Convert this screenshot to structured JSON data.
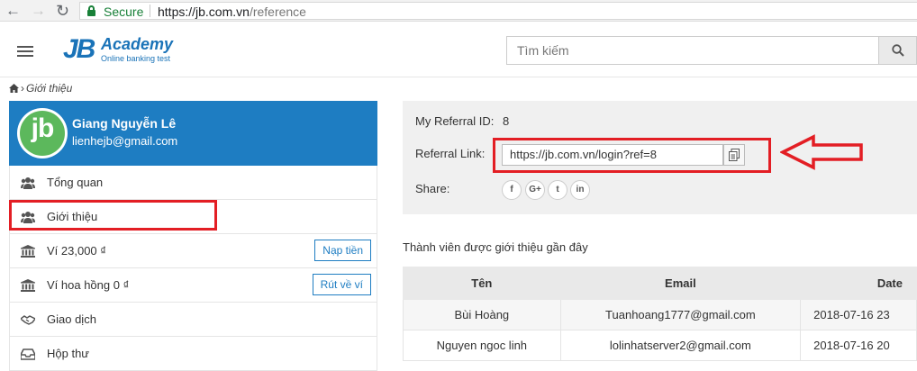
{
  "browser": {
    "secure_label": "Secure",
    "url_host": "https://jb.com.vn",
    "url_path": "/reference"
  },
  "header": {
    "logo_jb": "JB",
    "logo_academy": "Academy",
    "logo_tagline": "Online banking test",
    "search_placeholder": "Tìm kiếm"
  },
  "breadcrumb": {
    "current": "Giới thiệu"
  },
  "profile": {
    "avatar_text": "jb",
    "name": "Giang Nguyễn Lê",
    "email": "lienhejb@gmail.com"
  },
  "menu": {
    "items": [
      {
        "label": "Tổng quan",
        "icon": "users-icon"
      },
      {
        "label": "Giới thiệu",
        "icon": "users-icon"
      },
      {
        "label": "Ví 23,000 ₫",
        "icon": "bank-icon",
        "action": "Nạp tiền"
      },
      {
        "label": "Ví hoa hồng 0 ₫",
        "icon": "bank-icon",
        "action": "Rút về ví"
      },
      {
        "label": "Giao dịch",
        "icon": "handshake-icon"
      },
      {
        "label": "Hộp thư",
        "icon": "inbox-icon"
      }
    ]
  },
  "referral": {
    "id_label": "My Referral ID:",
    "id_value": "8",
    "link_label": "Referral Link:",
    "link_value": "https://jb.com.vn/login?ref=8",
    "share_label": "Share:",
    "share_buttons": [
      "f",
      "G+",
      "t",
      "in"
    ]
  },
  "recent": {
    "title": "Thành viên được giới thiệu gần đây",
    "columns": [
      "Tên",
      "Email",
      "Date"
    ],
    "rows": [
      [
        "Bùi Hoàng",
        "Tuanhoang1777@gmail.com",
        "2018-07-16 23"
      ],
      [
        "Nguyen ngoc linh",
        "lolinhatserver2@gmail.com",
        "2018-07-16 20"
      ]
    ]
  },
  "colors": {
    "primary": "#1e7dc2",
    "highlight": "#e31e24",
    "secure": "#188038",
    "avatar": "#5cb85c"
  }
}
